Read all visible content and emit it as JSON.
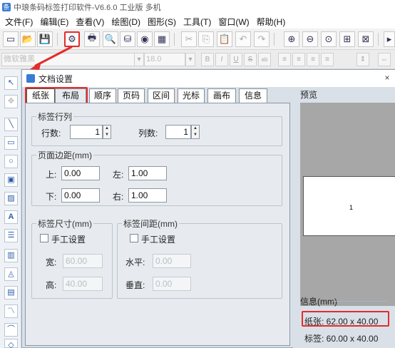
{
  "app": {
    "title": "中琅条码标签打印软件-V6.6.0 工业版 多机"
  },
  "menu": [
    "文件(F)",
    "编辑(E)",
    "查看(V)",
    "绘图(D)",
    "图形(S)",
    "工具(T)",
    "窗口(W)",
    "帮助(H)"
  ],
  "toolbar": {
    "icons": [
      "new-icon",
      "open-icon",
      "save-icon",
      "document-settings-icon",
      "print-icon",
      "print-preview-icon",
      "database-icon",
      "data-source-icon",
      "grid-icon",
      "cut-icon",
      "copy-icon",
      "paste-icon",
      "undo-icon",
      "redo-icon",
      "zoom-in-icon",
      "zoom-out-icon",
      "zoom-fit-icon",
      "zoom-page-icon",
      "zoom-actual-icon"
    ],
    "highlighted": "document-settings-icon"
  },
  "format_bar": {
    "font_name": "微软雅黑",
    "font_size": "18.0",
    "style_buttons": [
      "B",
      "I",
      "U",
      "S",
      "ab"
    ]
  },
  "dialog": {
    "title": "文档设置",
    "tabs": [
      "纸张",
      "布局",
      "顺序",
      "页码",
      "区间",
      "光标",
      "画布",
      "信息"
    ],
    "active_tab": "布局",
    "label_rows_cols": {
      "legend": "标签行列",
      "rows_label": "行数:",
      "rows_value": "1",
      "cols_label": "列数:",
      "cols_value": "1"
    },
    "margins": {
      "legend": "页面边距(mm)",
      "top_label": "上:",
      "top_value": "0.00",
      "left_label": "左:",
      "left_value": "1.00",
      "bottom_label": "下:",
      "bottom_value": "0.00",
      "right_label": "右:",
      "right_value": "1.00"
    },
    "label_size": {
      "legend": "标签尺寸(mm)",
      "manual_label": "手工设置",
      "width_label": "宽:",
      "width_value": "60.00",
      "height_label": "高:",
      "height_value": "40.00"
    },
    "label_spacing": {
      "legend": "标签间距(mm)",
      "manual_label": "手工设置",
      "h_label": "水平:",
      "h_value": "0.00",
      "v_label": "垂直:",
      "v_value": "0.00"
    },
    "preview": {
      "label": "预览",
      "paper_text": "1"
    },
    "info": {
      "legend": "信息(mm)",
      "paper": "纸张: 62.00 x 40.00",
      "label": "标签: 60.00 x 40.00"
    }
  },
  "colors": {
    "highlight": "#e52b2b",
    "accent": "#3a7bd5"
  }
}
